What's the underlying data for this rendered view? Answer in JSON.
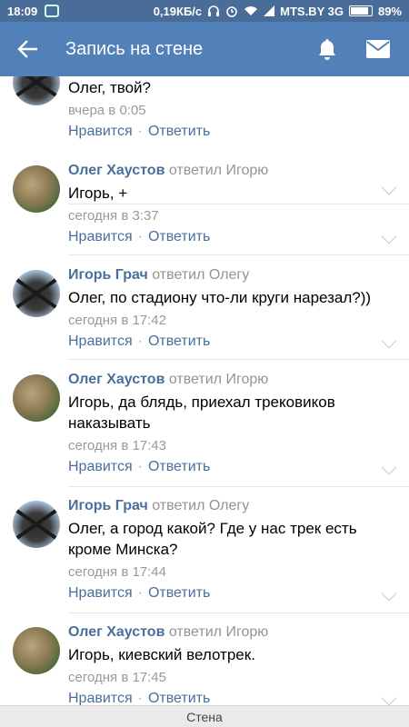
{
  "status_bar": {
    "time": "18:09",
    "speed": "0,19КБ/с",
    "carrier": "MTS.BY 3G",
    "battery": "89%"
  },
  "toolbar": {
    "title": "Запись на стене",
    "back_icon": "arrow-left-icon",
    "bell_icon": "bell-icon",
    "mail_icon": "mail-icon"
  },
  "comments": [
    {
      "author": "",
      "replied": "",
      "text": "Олег, твой?",
      "time": "вчера в 0:05",
      "like": "Нравится",
      "reply": "Ответить",
      "avatar": "igor"
    },
    {
      "author": "Олег Хаустов",
      "replied": " ответил Игорю",
      "text": "Игорь, +",
      "time": "сегодня в 3:37",
      "like": "Нравится",
      "reply": "Ответить",
      "avatar": "oleg"
    },
    {
      "author": "Игорь Грач",
      "replied": " ответил Олегу",
      "text": "Олег, по стадиону что-ли круги нарезал?))",
      "time": "сегодня в 17:42",
      "like": "Нравится",
      "reply": "Ответить",
      "avatar": "igor"
    },
    {
      "author": "Олег Хаустов",
      "replied": " ответил Игорю",
      "text": "Игорь, да блядь, приехал трековиков наказывать",
      "time": "сегодня в 17:43",
      "like": "Нравится",
      "reply": "Ответить",
      "avatar": "oleg"
    },
    {
      "author": "Игорь Грач",
      "replied": " ответил Олегу",
      "text": "Олег, а город какой? Где у нас трек есть кроме Минска?",
      "time": "сегодня в 17:44",
      "like": "Нравится",
      "reply": "Ответить",
      "avatar": "igor"
    },
    {
      "author": "Олег Хаустов",
      "replied": " ответил Игорю",
      "text": "Игорь, киевский велотрек.",
      "time": "сегодня в 17:45",
      "like": "Нравится",
      "reply": "Ответить",
      "avatar": "oleg"
    }
  ],
  "bottom_bar": {
    "label": "Стена"
  }
}
